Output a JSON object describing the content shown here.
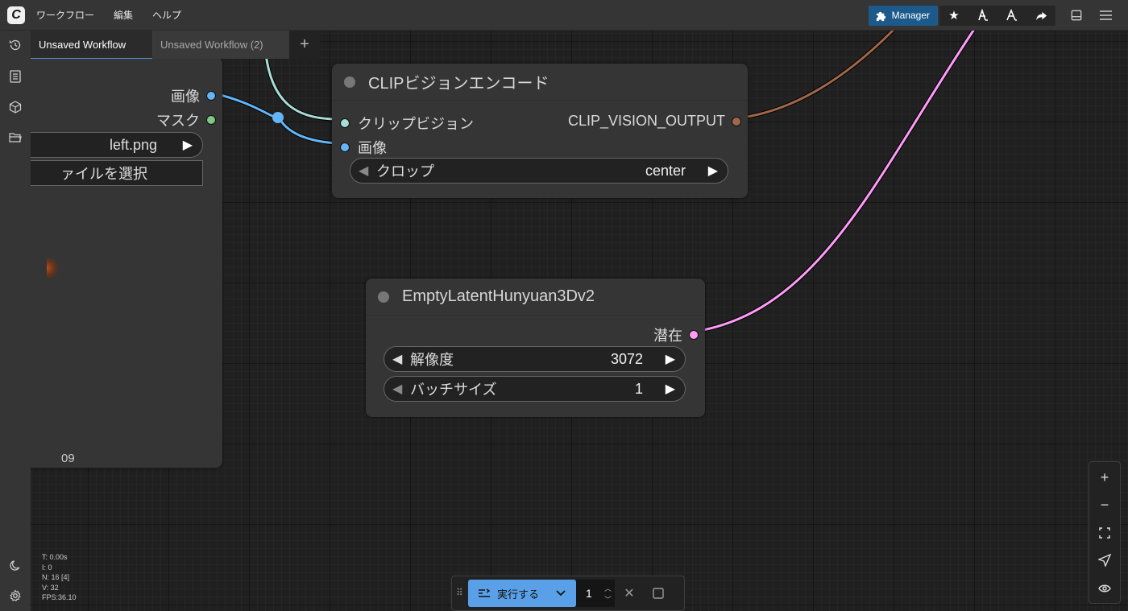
{
  "menu": {
    "logo_letter": "C",
    "items": [
      "ワークフロー",
      "編集",
      "ヘルプ"
    ]
  },
  "topbar": {
    "manager_label": "Manager",
    "icons": [
      "star-icon",
      "model-icon",
      "model-alt-icon",
      "share-icon",
      "panel-icon",
      "hamburger-icon"
    ]
  },
  "sidebar": {
    "icons": [
      "history-icon",
      "document-icon",
      "cube-icon",
      "folder-icon",
      "moon-icon",
      "gear-icon"
    ]
  },
  "tabs": [
    {
      "label": "Unsaved Workflow",
      "active": true
    },
    {
      "label": "Unsaved Workflow (2)",
      "active": false
    }
  ],
  "load_image_node": {
    "outputs": [
      "画像",
      "マスク"
    ],
    "image_value": "left.png",
    "upload_label": "ァイルを選択",
    "footer_text": "09"
  },
  "clip_node": {
    "title": "CLIPビジョンエンコード",
    "inputs": [
      "クリップビジョン",
      "画像"
    ],
    "output": "CLIP_VISION_OUTPUT",
    "widget": {
      "label": "クロップ",
      "value": "center"
    }
  },
  "latent_node": {
    "title": "EmptyLatentHunyuan3Dv2",
    "output": "潜在",
    "widgets": [
      {
        "label": "解像度",
        "value": "3072"
      },
      {
        "label": "バッチサイズ",
        "value": "1"
      }
    ]
  },
  "stats": {
    "t": "T: 0.00s",
    "i": "I: 0",
    "n": "N: 16 [4]",
    "v": "V: 32",
    "fps": "FPS:36.10"
  },
  "runbar": {
    "run_label": "実行する",
    "queue_count": "1"
  },
  "colors": {
    "clip_vision_wire": "#a8dcd6",
    "image_wire": "#64b5f6",
    "clip_output_wire": "#a0674a",
    "latent_wire": "#ff9cf9",
    "mask_slot": "#81c784",
    "accent": "#5aa0e8"
  }
}
